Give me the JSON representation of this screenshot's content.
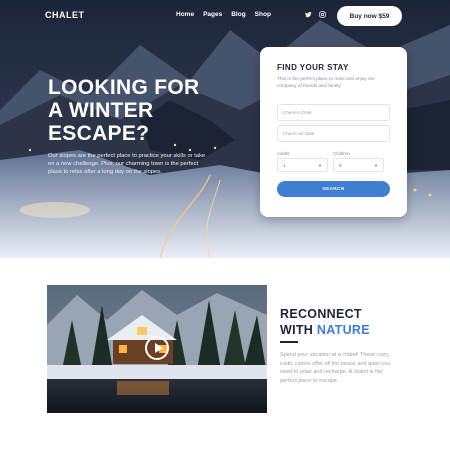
{
  "header": {
    "logo": "CHALET",
    "nav": [
      "Home",
      "Pages",
      "Blog",
      "Shop"
    ],
    "social_icons": [
      "twitter-icon",
      "instagram-icon"
    ],
    "buy_label": "Buy now $59"
  },
  "hero": {
    "title_lines": [
      "LOOKING FOR",
      "A WINTER",
      "ESCAPE?"
    ],
    "text": "Our slopes are the perfect place to practice your skills or take on a new challenge. Plus, our charming town is the perfect place to relax after a long day on the slopes."
  },
  "booking": {
    "title": "FIND YOUR STAY",
    "text": "This is the perfect place to relax and enjoy the company of friends and family.",
    "check_in_placeholder": "Check-in Date",
    "check_out_placeholder": "Check-out Date",
    "adults_label": "Adults",
    "children_label": "Children",
    "adults_value": "1",
    "children_value": "0",
    "search_label": "SEARCH"
  },
  "about": {
    "title_line1": "RECONNECT",
    "title_line2_prefix": "WITH ",
    "title_line2_accent": "NATURE",
    "text": "Spend your vacation at a chalet! These cozy, rustic cabins offer all the peace and quiet you need to relax and recharge. A chalet is the perfect place to escape."
  },
  "colors": {
    "accent": "#3f7fd1",
    "dark": "#1d2438"
  }
}
